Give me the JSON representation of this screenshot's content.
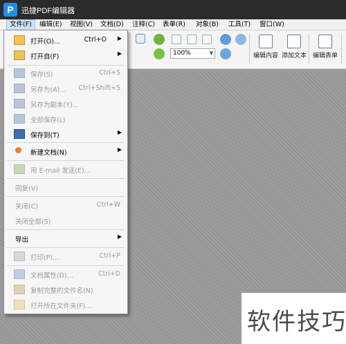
{
  "app": {
    "title": "迅捷PDF编辑器",
    "logo_letter": "P"
  },
  "menubar": {
    "items": [
      "文件(F)",
      "编辑(E)",
      "视图(V)",
      "文档(D)",
      "注释(C)",
      "表单(R)",
      "对象(B)",
      "工具(T)",
      "窗口(W)"
    ]
  },
  "toolbar": {
    "zoom_value": "100%",
    "edit_content": "编辑内容",
    "add_text": "添加文本",
    "edit_form": "编辑表单"
  },
  "file_menu": {
    "open": {
      "label": "打开(O)...",
      "shortcut": "Ctrl+O"
    },
    "open_from": {
      "label": "打开自(F)"
    },
    "save": {
      "label": "保存(S)",
      "shortcut": "Ctrl+S"
    },
    "save_as": {
      "label": "另存为(A)...",
      "shortcut": "Ctrl+Shift+S"
    },
    "save_copy": {
      "label": "另存为副本(Y)..."
    },
    "save_all": {
      "label": "全部保存(L)"
    },
    "save_to": {
      "label": "保存到(T)"
    },
    "new_document": {
      "label": "新建文档(N)"
    },
    "email": {
      "label": "用 E-mail 发送(E)..."
    },
    "revert": {
      "label": "回复(V)"
    },
    "close": {
      "label": "关闭(C)",
      "shortcut": "Ctrl+W"
    },
    "close_all": {
      "label": "关闭全部(S)"
    },
    "export": {
      "label": "导出"
    },
    "print": {
      "label": "打印(P)...",
      "shortcut": "Ctrl+P"
    },
    "properties": {
      "label": "文档属性(D)...",
      "shortcut": "Ctrl+D"
    },
    "copy_filename": {
      "label": "复制完整的文件名(N)"
    },
    "open_folder": {
      "label": "打开所在文件夹(F)..."
    }
  },
  "watermark": {
    "text": "软件技巧"
  },
  "colors": {
    "titlebar": "#2b2b2b",
    "logo": "#1e8fe8",
    "menu_active": "#cfe3f7",
    "canvas": "#9a9a9a"
  }
}
